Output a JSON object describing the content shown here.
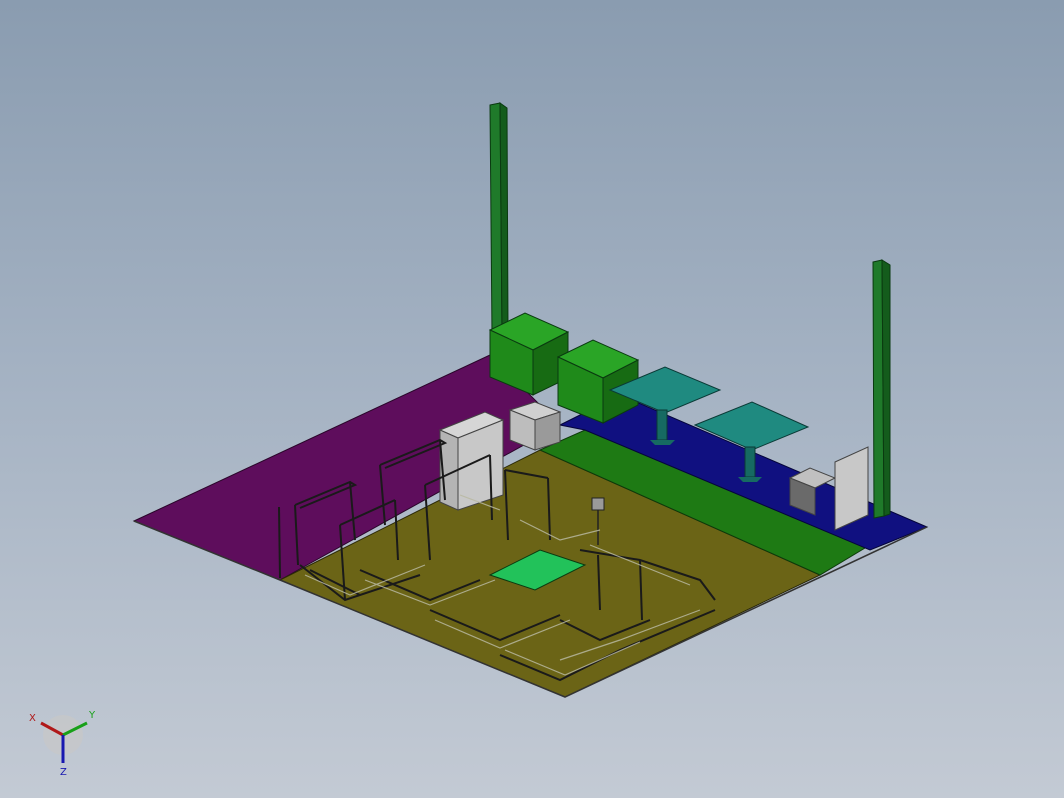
{
  "colors": {
    "background_top": "#8a9cb0",
    "background_bottom": "#c3cad4",
    "floor_magenta": "#5e0d5c",
    "floor_olive": "#6b6416",
    "floor_green": "#1e7a14",
    "floor_navy": "#101080",
    "box_green": "#1f8a1a",
    "table_teal": "#1f8a80",
    "column_green": "#1f7a2a",
    "cabinet_grey": "#b8b8b8",
    "frame_dark": "#1a1a1a",
    "pad_green": "#22c25a"
  },
  "triad": {
    "x_label": "X",
    "y_label": "Y",
    "z_label": "Z",
    "x_color": "#b01818",
    "y_color": "#18a018",
    "z_color": "#1818b0"
  },
  "scene": {
    "description_icons": [
      "assembly-model",
      "coordinate-triad-icon"
    ]
  }
}
